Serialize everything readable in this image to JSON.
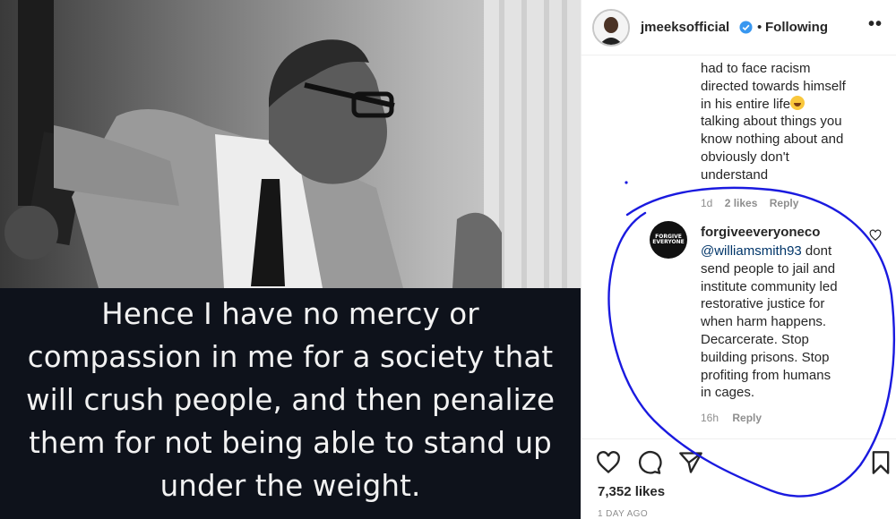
{
  "post": {
    "caption_lines": [
      "Hence I have no mercy or",
      "compassion in me for a society that",
      "will crush people, and then penalize",
      "them for not being able to stand up",
      "under the weight."
    ]
  },
  "header": {
    "username": "jmeeksofficial",
    "separator": "•",
    "follow_state": "Following",
    "more": "••"
  },
  "comments": {
    "previous": {
      "text_lines": [
        "had to face racism",
        "directed towards himself",
        "in his entire life",
        "talking about things you",
        "know nothing about and",
        "obviously don't",
        "understand"
      ],
      "age": "1d",
      "likes": "2 likes",
      "reply": "Reply"
    },
    "highlighted": {
      "username": "forgiveeveryoneco",
      "avatar_text": "FORGIVE EVERYONE",
      "mention": "@williamsmith93",
      "text_lines": [
        " dont",
        "send people to jail and",
        "institute community led",
        "restorative justice for",
        "when harm happens.",
        "Decarcerate. Stop",
        "building prisons. Stop",
        "profiting from humans",
        "in cages."
      ],
      "age": "16h",
      "reply": "Reply"
    }
  },
  "footer": {
    "likes": "7,352 likes",
    "time": "1 DAY AGO"
  },
  "icons": {
    "verified": "verified-badge-icon",
    "like": "heart-icon",
    "comment": "comment-icon",
    "share": "paper-plane-icon",
    "save": "bookmark-icon",
    "annotation": "hand-drawn-circle"
  },
  "colors": {
    "verified": "#3897f0",
    "annotation": "#1a1adf",
    "caption_band": "#0e121b",
    "mention": "#003569",
    "muted": "#8e8e8e"
  }
}
